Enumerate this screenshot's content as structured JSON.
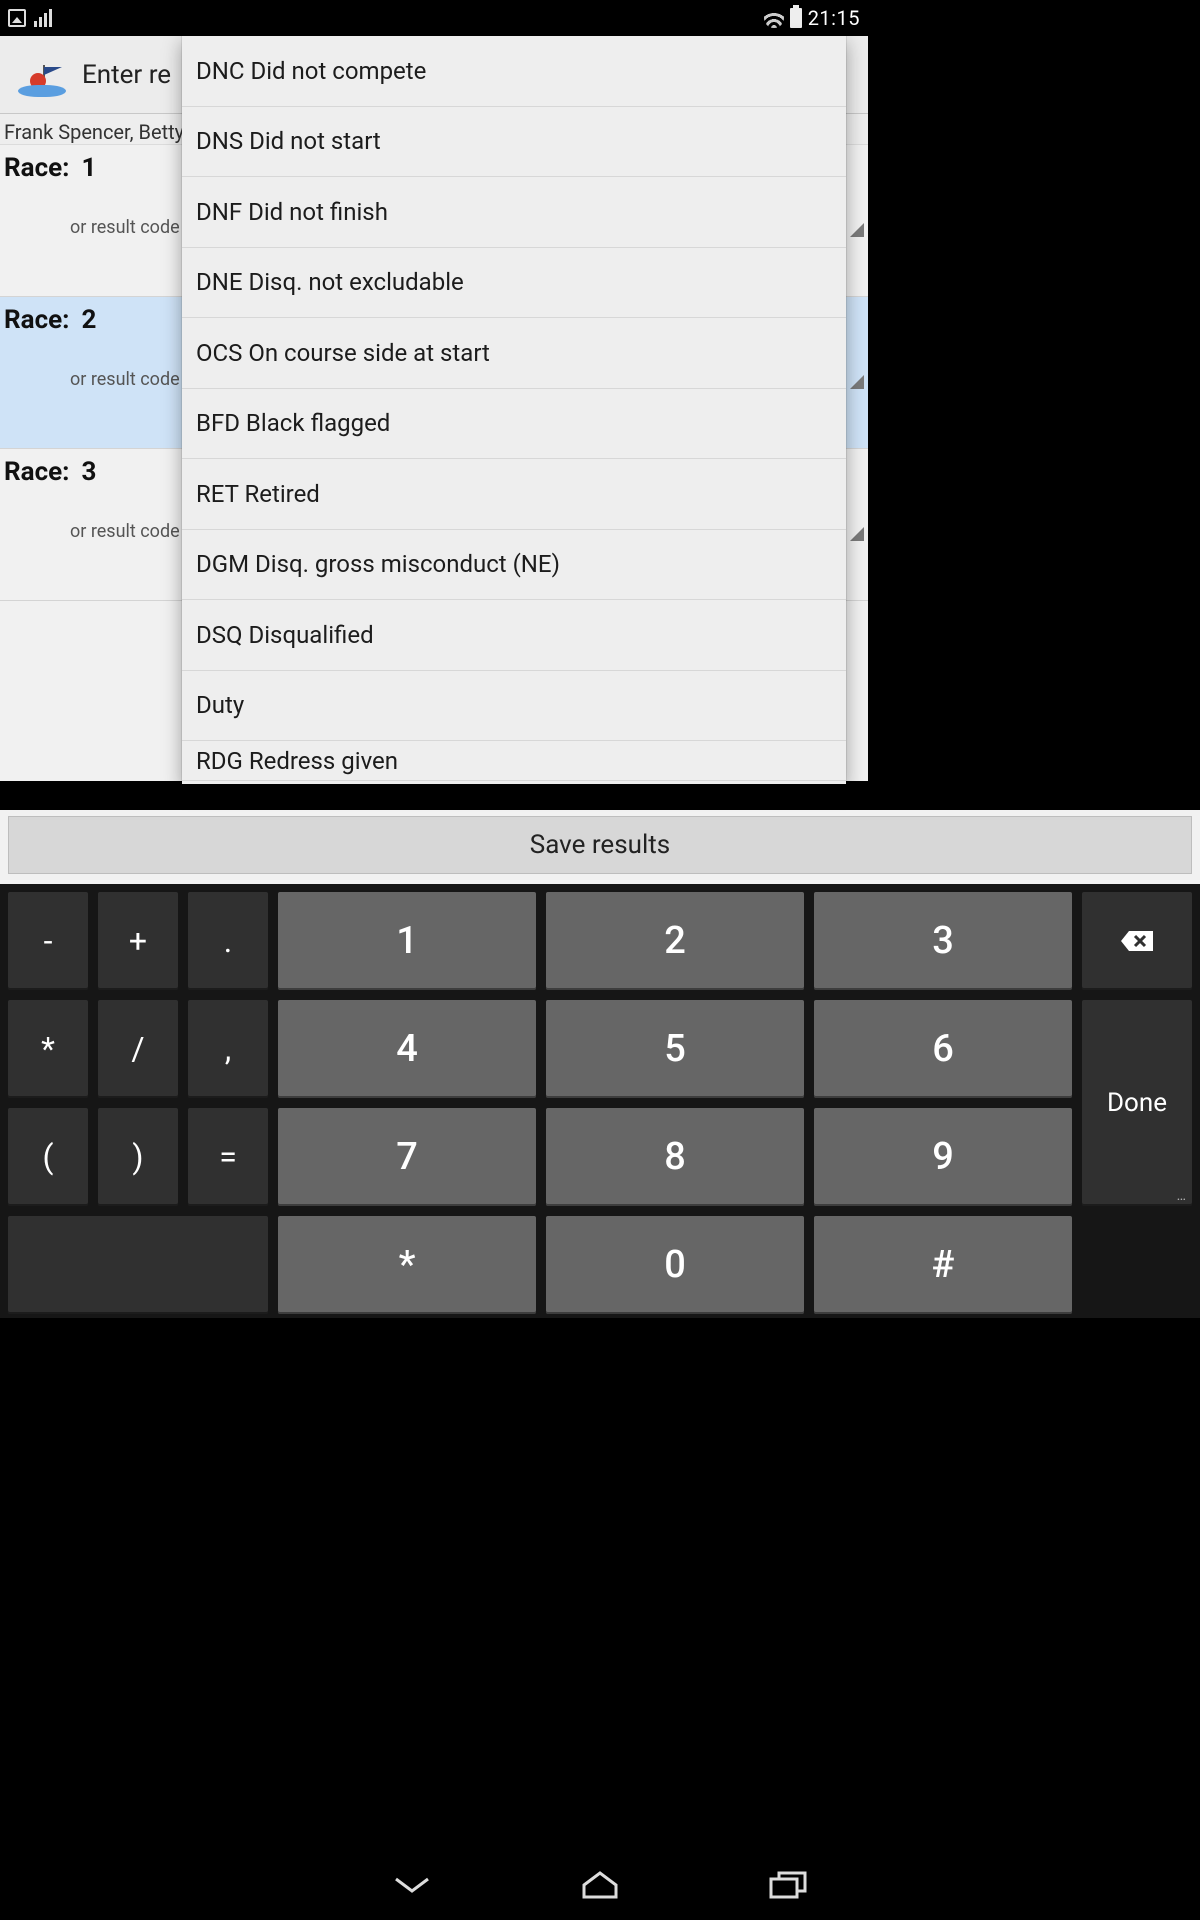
{
  "status": {
    "time": "21:15"
  },
  "header": {
    "title": "Enter re"
  },
  "subtitle": "Frank Spencer, Betty",
  "race_label": "Race:",
  "or_code_label": "or result code",
  "races": [
    {
      "num": "1",
      "selected": false
    },
    {
      "num": "2",
      "selected": true
    },
    {
      "num": "3",
      "selected": false
    }
  ],
  "save_button": "Save results",
  "result_codes": [
    "DNC Did not compete",
    "DNS Did not start",
    "DNF Did not finish",
    "DNE Disq. not excludable",
    "OCS On course side at start",
    "BFD Black flagged",
    "RET Retired",
    "DGM Disq. gross misconduct (NE)",
    "DSQ Disqualified",
    "Duty",
    "RDG Redress given"
  ],
  "keypad": {
    "rows": [
      [
        "-",
        "+",
        ".",
        "1",
        "2",
        "3",
        "⌫"
      ],
      [
        "*",
        "/",
        ",",
        "4",
        "5",
        "6",
        "Done"
      ],
      [
        "(",
        ")",
        "=",
        "7",
        "8",
        "9",
        ""
      ],
      [
        "",
        "",
        "",
        "*",
        "0",
        "#",
        ""
      ]
    ],
    "done": "Done"
  }
}
